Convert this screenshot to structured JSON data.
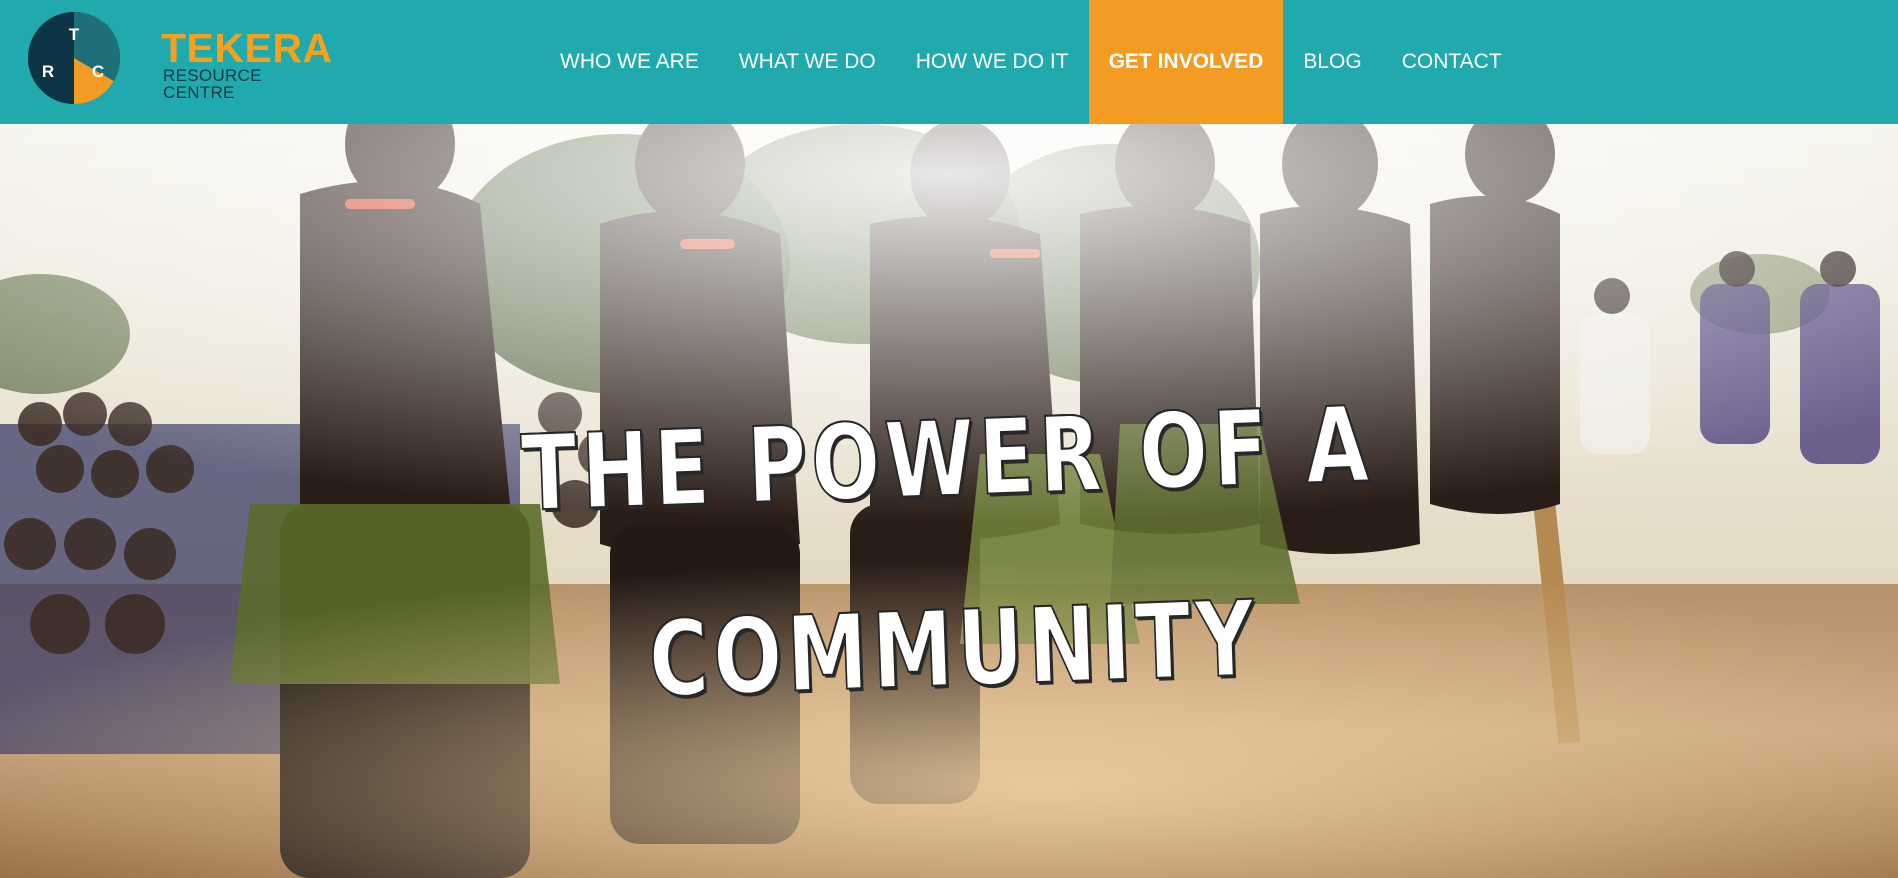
{
  "logo": {
    "letters": {
      "top": "T",
      "left": "R",
      "right": "C"
    },
    "name": "TEKERA",
    "subtitle": "RESOURCE CENTRE",
    "colors": {
      "teal": "#1f6f78",
      "navy": "#0d3444",
      "orange": "#f39b22"
    }
  },
  "nav": {
    "items": [
      {
        "label": "WHO WE ARE"
      },
      {
        "label": "WHAT WE DO"
      },
      {
        "label": "HOW WE DO IT"
      },
      {
        "label": "GET INVOLVED",
        "active": true
      },
      {
        "label": "BLOG"
      },
      {
        "label": "CONTACT"
      }
    ]
  },
  "hero": {
    "title_line1": "THE POWER OF A",
    "title_line2": "COMMUNITY",
    "image_icon": "photo-icon"
  },
  "colors": {
    "header_bg": "#20aaae",
    "accent": "#f39b22",
    "nav_text": "#ffffff"
  }
}
